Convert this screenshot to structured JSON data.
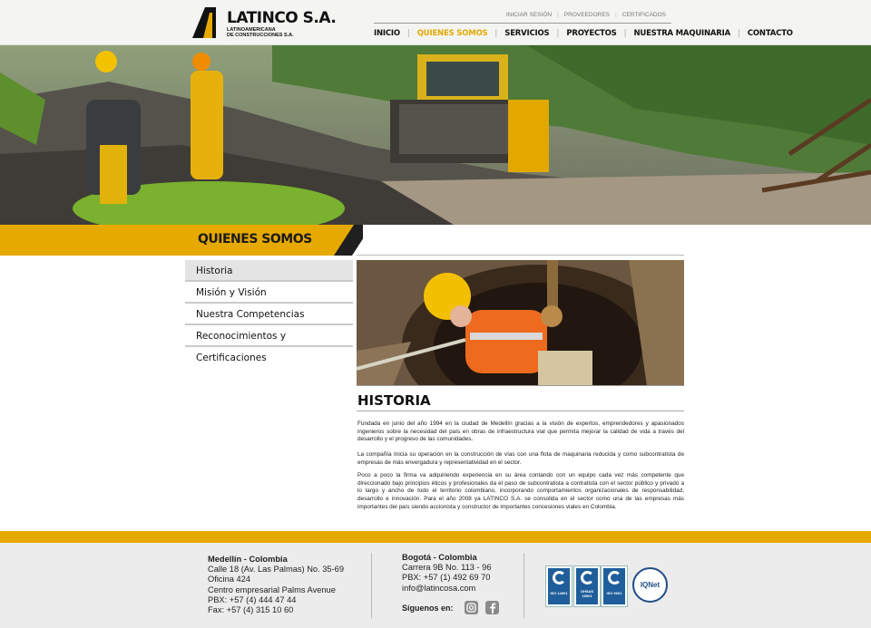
{
  "brand": {
    "name": "LATINCO S.A.",
    "sub_line1": "LATINOAMERICANA",
    "sub_line2": "DE CONSTRUCCIONES S.A."
  },
  "utility_links": [
    "INICIAR SESIÓN",
    "PROVEEDORES",
    "CERTIFICADOS"
  ],
  "nav": {
    "items": [
      "INICIO",
      "QUIENES SOMOS",
      "SERVICIOS",
      "PROYECTOS",
      "NUESTRA MAQUINARIA",
      "CONTACTO"
    ],
    "active": "QUIENES SOMOS"
  },
  "section_title": "QUIENES SOMOS",
  "sidebar": {
    "items": [
      "Historia",
      "Misión y Visión",
      "Nuestra Competencias",
      "Reconocimientos y Certificaciones"
    ],
    "active": "Historia"
  },
  "content": {
    "title": "HISTORIA",
    "paragraphs": [
      "Fundada en junio del año 1994 en la ciudad de Medellín gracias a la visión de expertos, emprendedores y apasionados ingenieros sobre la necesidad del país en obras de infraestructura vial que permita mejorar la calidad de vida a través del desarrollo y el progreso de las comunidades.",
      "La compañía Inicia su operación en la construcción de vías con una flota de maquinaria reducida y como subcontratista de empresas de más envergadura y representatividad en el sector.",
      "Poco a poco la firma va adquiriendo experiencia en su área contando con un equipo cada vez más competente que direccionado bajo principios éticos y profesionales da el paso de subcontratista a contratista con el sector público y privado a lo largo y ancho de todo el territorio colombiano, incorporando comportamientos organizacionales de responsabilidad, desarrollo e innovación. Para el año 2008 ya LATINCO S.A. se consolida en el sector como una de las empresas más importantes del país siendo accionista y constructor de importantes concesiones viales en Colombia."
    ]
  },
  "footer": {
    "medellin": {
      "city": "Medellín - Colombia",
      "lines": [
        "Calle 18 (Av. Las Palmas) No. 35-69",
        "Oficina 424",
        "Centro empresarial Palms Avenue",
        "PBX: +57 (4) 444 47 44",
        "Fax: +57 (4) 315 10 60"
      ]
    },
    "bogota": {
      "city": "Bogotá - Colombia",
      "lines": [
        "Carrera 9B No. 113 - 96",
        "PBX: +57 (1) 492 69 70",
        "info@latincosa.com"
      ]
    },
    "social_label": "Síguenos en:",
    "social_icons": [
      "instagram-icon",
      "facebook-icon"
    ],
    "certifications": [
      "ISO 14001",
      "OHSAS 18001",
      "ISO 9001"
    ],
    "iqnet": "IQNet"
  },
  "colors": {
    "accent": "#e6a900",
    "active_nav": "#e2a900",
    "text": "#222222",
    "footer_bg": "#ececec",
    "cert_blue": "#1f5e9b"
  }
}
